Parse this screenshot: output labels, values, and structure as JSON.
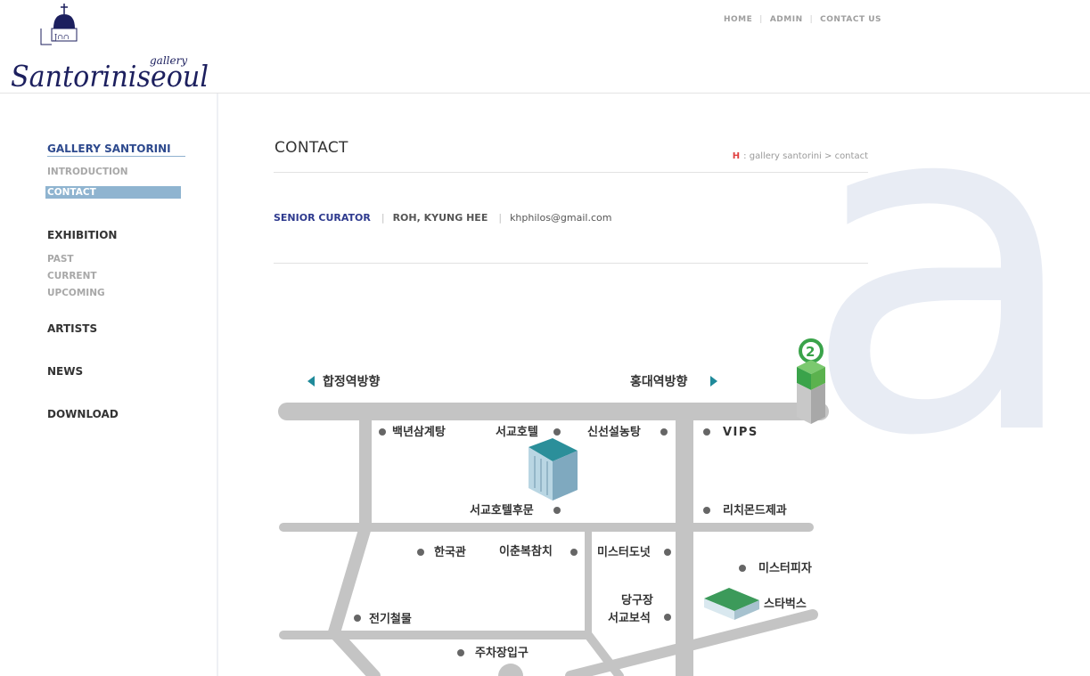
{
  "header": {
    "logo_word_small": "gallery",
    "logo_word_main": "Santoriniseoul",
    "logo_tag": "J∩∩",
    "nav": [
      {
        "label": "HOME"
      },
      {
        "label": "ADMIN"
      },
      {
        "label": "CONTACT US"
      }
    ]
  },
  "sidebar": {
    "gallery_section": {
      "title": "GALLERY SANTORINI",
      "items": [
        {
          "label": "INTRODUCTION"
        },
        {
          "label": "CONTACT"
        }
      ]
    },
    "exhibition_section": {
      "title": "EXHIBITION",
      "items": [
        {
          "label": "PAST"
        },
        {
          "label": "CURRENT"
        },
        {
          "label": "UPCOMING"
        }
      ]
    },
    "artists": "ARTISTS",
    "news": "NEWS",
    "download": "DOWNLOAD"
  },
  "main": {
    "page_title": "CONTACT",
    "breadcrumb_home": "H",
    "breadcrumb_path": ": gallery santorini > contact",
    "contact": {
      "role": "SENIOR CURATOR",
      "name": "ROH, KYUNG HEE",
      "email": "khphilos@gmail.com"
    }
  },
  "map": {
    "direction_left": "합정역방향",
    "direction_right": "홍대역방향",
    "subway_line": "2",
    "places": {
      "baeknyeon": "백년삼계탕",
      "seogyo_hotel": "서교호텔",
      "sinseon": "신선설농탕",
      "vips": "VIPS",
      "hotel_back": "서교호텔후문",
      "richmond": "리치몬드제과",
      "hangukgwan": "한국관",
      "ichun": "이춘복참치",
      "mister_donut": "미스터도넛",
      "mister_pizza": "미스터피자",
      "danggujang": "당구장",
      "seogyo_jewel": "서교보석",
      "starbucks": "스타벅스",
      "jeongi": "전기철물",
      "parking": "주차장입구"
    },
    "colors": {
      "road": "#c4c4c4",
      "arrow": "#1f8a9a",
      "subway_green": "#3aa34a",
      "marker": "#666666"
    }
  }
}
